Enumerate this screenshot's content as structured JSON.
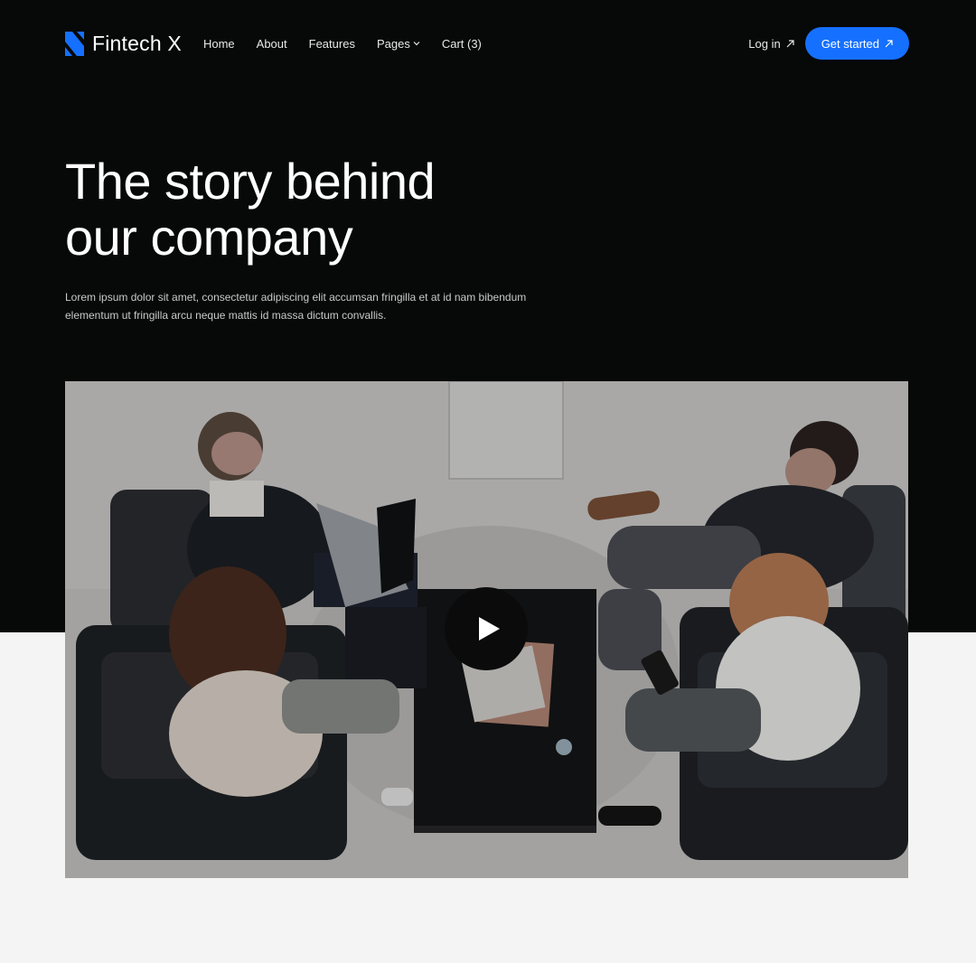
{
  "header": {
    "brand_name": "Fintech X",
    "brand_color": "#1570ff",
    "nav": [
      {
        "label": "Home"
      },
      {
        "label": "About"
      },
      {
        "label": "Features"
      },
      {
        "label": "Pages"
      },
      {
        "label": "Cart (3)"
      }
    ],
    "login_label": "Log in",
    "cta_label": "Get started"
  },
  "hero": {
    "title_line1": "The story behind",
    "title_line2": "our company",
    "subtitle": "Lorem ipsum dolor sit amet, consectetur adipiscing elit accumsan fringilla et at id nam bibendum elementum ut fringilla arcu neque mattis id massa dictum convallis."
  },
  "media": {
    "image_subject": "team-meeting-photo",
    "play_icon": "play-icon"
  },
  "colors": {
    "hero_background": "#070808",
    "page_background": "#f4f4f4",
    "accent": "#1570ff"
  }
}
